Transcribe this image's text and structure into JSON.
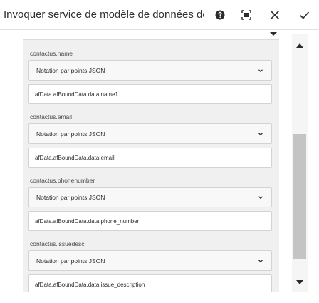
{
  "dialog": {
    "title": "Invoquer service de modèle de données de for...",
    "icons": {
      "help": "help-icon",
      "fullscreen": "fullscreen-icon",
      "close": "close-icon",
      "confirm": "checkmark-icon"
    }
  },
  "fields": [
    {
      "label": "contactus.name",
      "select_value": "Notation par points JSON",
      "input_value": "afData.afBoundData.data.name1"
    },
    {
      "label": "contactus.email",
      "select_value": "Notation par points JSON",
      "input_value": "afData.afBoundData.data.email"
    },
    {
      "label": "contactus.phonenumber",
      "select_value": "Notation par points JSON",
      "input_value": "afData.afBoundData.data.phone_number"
    },
    {
      "label": "contactus.issuedesc",
      "select_value": "Notation par points JSON",
      "input_value": "afData.afBoundData.data.issue_description"
    }
  ],
  "colors": {
    "background": "#ffffff",
    "panel": "#f0f0f0",
    "border": "#d3d3d3",
    "scrollbar_thumb": "#c4c4c4",
    "text": "#2c2c2c"
  }
}
